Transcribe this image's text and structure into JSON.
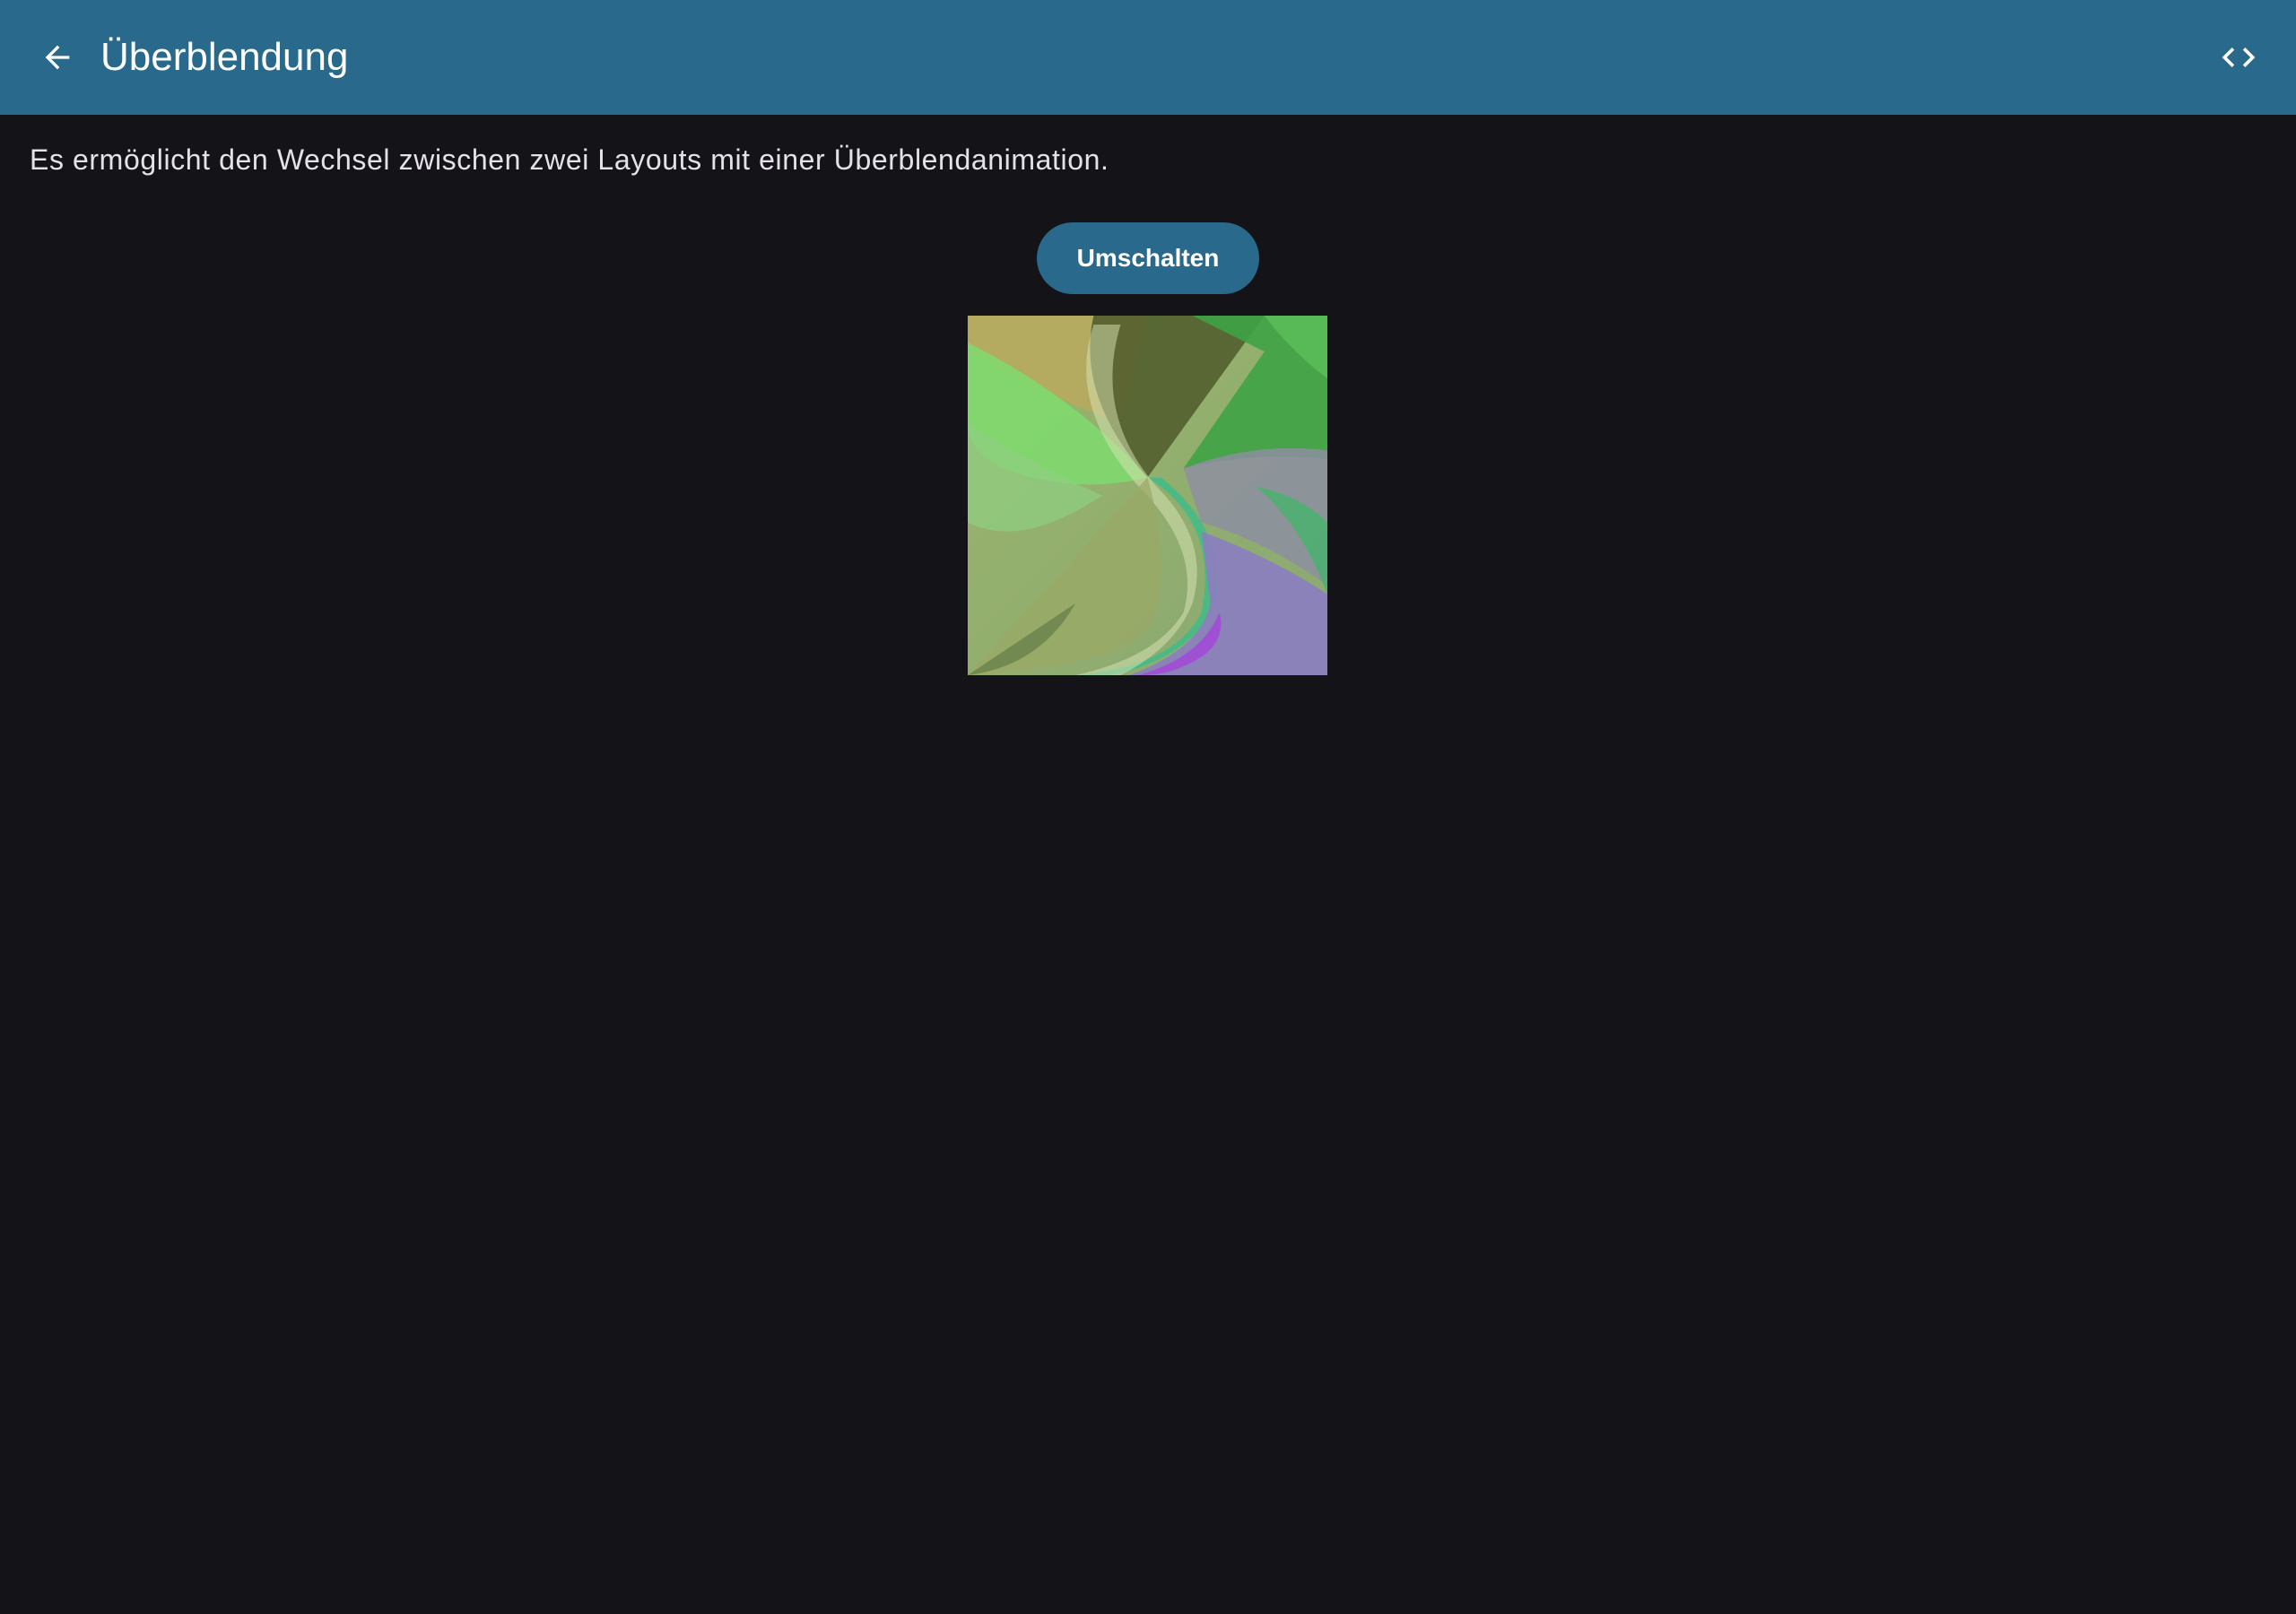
{
  "app_bar": {
    "title": "Überblendung",
    "back_icon": "arrow-back-icon",
    "code_icon": "code-icon",
    "background_color": "#29698c"
  },
  "main": {
    "description": "Es ermöglicht den Wechsel zwischen zwei Layouts mit einer Überblendanimation.",
    "toggle_label": "Umschalten"
  },
  "colors": {
    "background": "#141318",
    "accent": "#29698c",
    "on_accent": "#ffffff",
    "text": "#e4e1e8"
  }
}
